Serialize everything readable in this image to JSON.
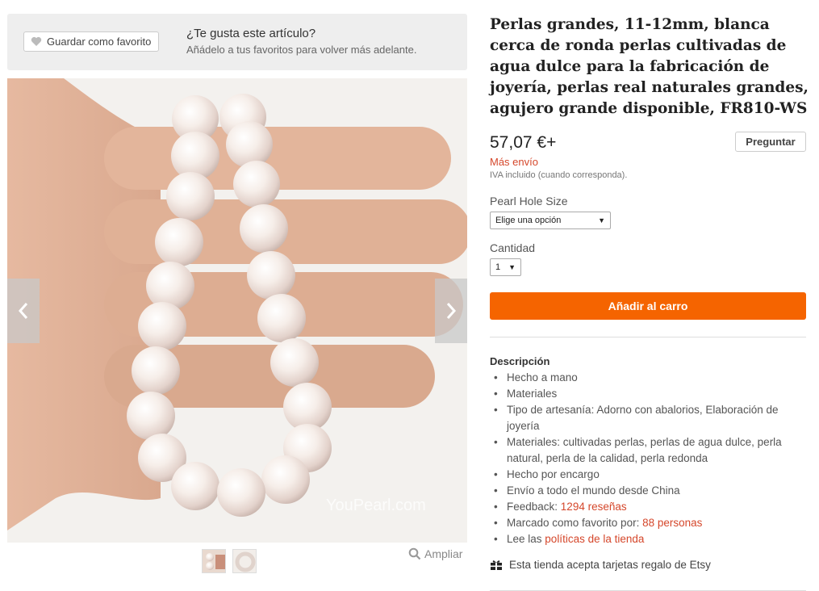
{
  "favorites_bar": {
    "button_label": "Guardar como favorito",
    "prompt_title": "¿Te gusta este artículo?",
    "prompt_subtitle": "Añádelo a tus favoritos para volver más adelante."
  },
  "gallery": {
    "watermark": "YouPearl.com",
    "zoom_label": "Ampliar"
  },
  "product": {
    "title": "Perlas grandes, 11-12mm, blanca cerca de ronda perlas cultivadas de agua dulce para la fabricación de joyería, perlas real naturales grandes, agujero grande disponible, FR810-WS",
    "price": "57,07 €+",
    "ask_button": "Preguntar",
    "shipping_note": "Más envío",
    "vat_note": "IVA incluido (cuando corresponda)."
  },
  "options": {
    "hole_size_label": "Pearl Hole Size",
    "hole_size_selected": "Elige una opción",
    "quantity_label": "Cantidad",
    "quantity_selected": "1"
  },
  "add_to_cart_label": "Añadir al carro",
  "description": {
    "title": "Descripción",
    "items": {
      "handmade": "Hecho a mano",
      "materials": "Materiales",
      "craft_type": "Tipo de artesanía: Adorno con abalorios, Elaboración de joyería",
      "materials_detail": "Materiales: cultivadas perlas, perlas de agua dulce, perla natural, perla de la calidad, perla redonda",
      "made_to_order": "Hecho por encargo",
      "worldwide": "Envío a todo el mundo desde China",
      "feedback_label": "Feedback: ",
      "feedback_link": "1294 reseñas",
      "favorited_label": "Marcado como favorito por: ",
      "favorited_link": "88 personas",
      "policies_label": "Lee las ",
      "policies_link": "políticas de la tienda"
    }
  },
  "gift_card_note": "Esta tienda acepta tarjetas regalo de Etsy",
  "colors": {
    "accent_orange": "#f56400",
    "link_red": "#d5472b"
  }
}
